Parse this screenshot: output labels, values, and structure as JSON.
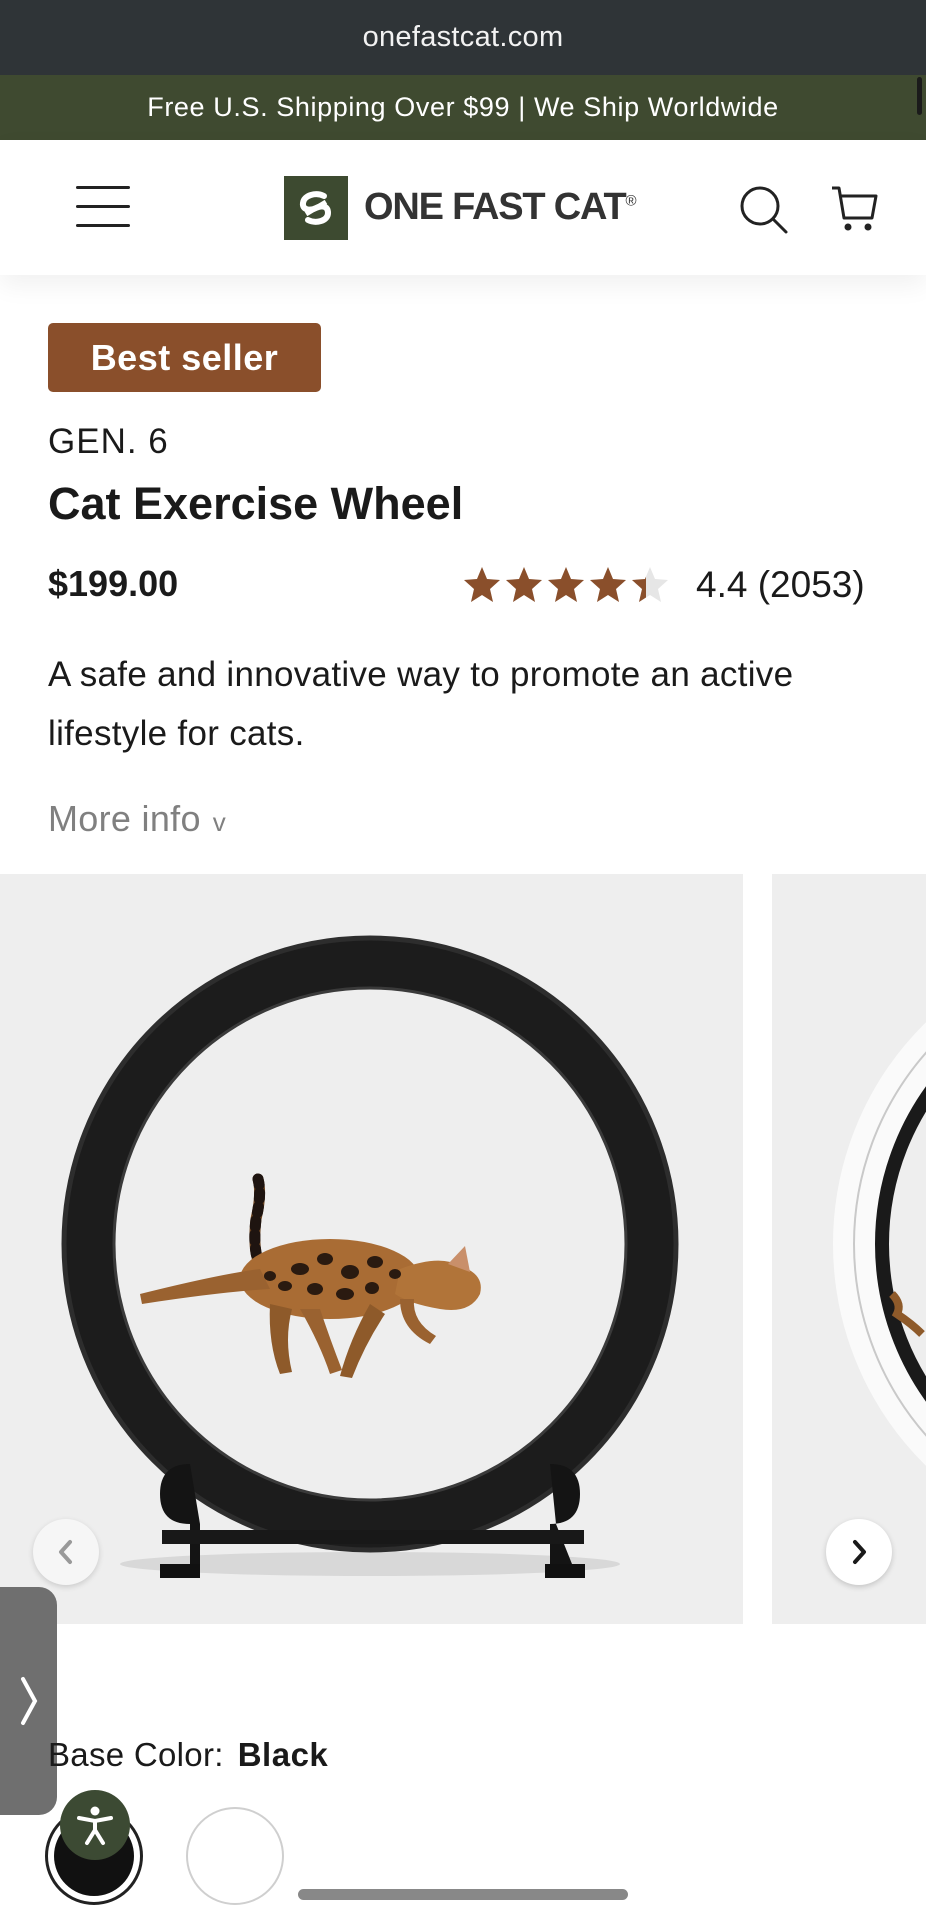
{
  "browser": {
    "url": "onefastcat.com"
  },
  "promo": {
    "text": "Free U.S. Shipping Over $99 | We Ship Worldwide"
  },
  "header": {
    "logo_text": "ONE FAST CAT",
    "logo_mark": "®"
  },
  "product": {
    "badge": "Best seller",
    "generation": "GEN. 6",
    "title": "Cat Exercise Wheel",
    "price": "$199.00",
    "rating_value": 4.4,
    "rating_text": "4.4 (2053)",
    "description": "A safe and innovative way to promote an active lifestyle for cats.",
    "more_info": "More info",
    "more_info_chevron": "v"
  },
  "gallery": {
    "prev_icon": "chevron-left-icon",
    "next_icon": "chevron-right-icon"
  },
  "options": {
    "base_color_label": "Base Color:",
    "base_color_value": "Black",
    "swatches": [
      "Black",
      "White"
    ]
  },
  "colors": {
    "brand_green": "#3f4a30",
    "badge_brown": "#8a4f2b",
    "star": "#8a4f2b"
  }
}
